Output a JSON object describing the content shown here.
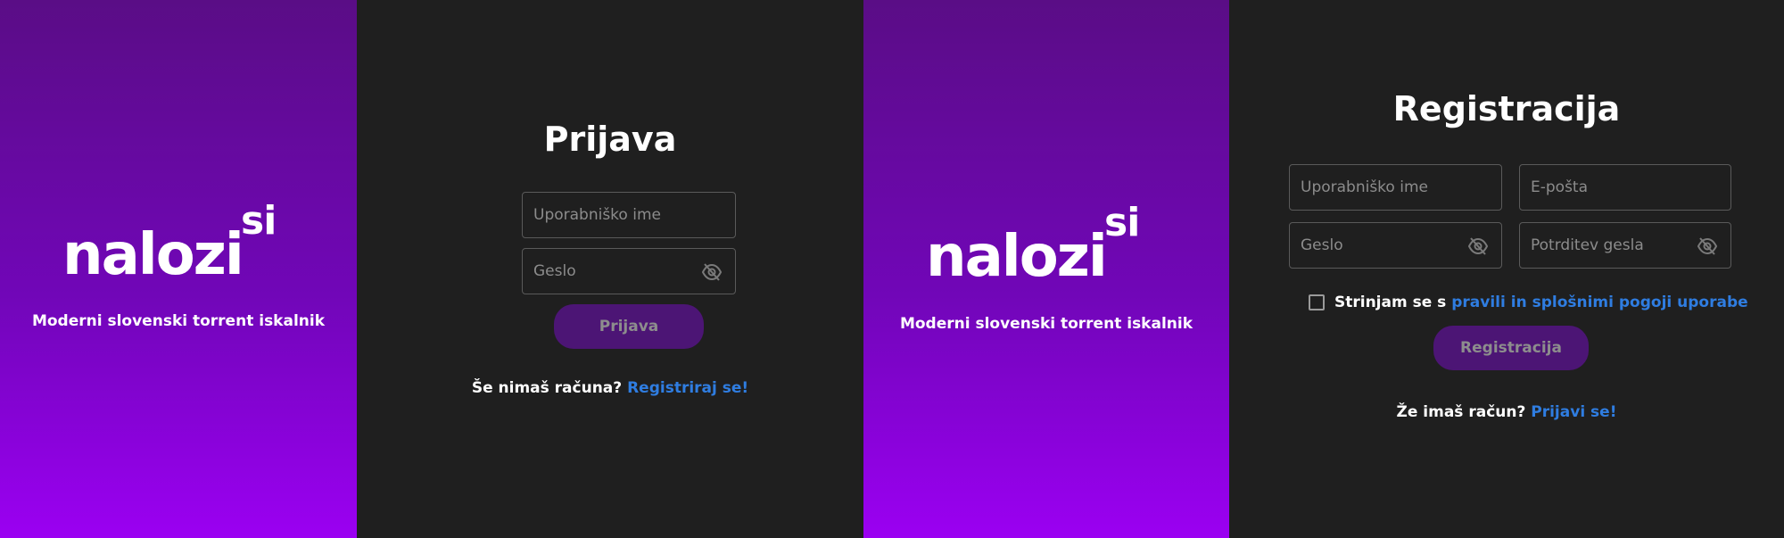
{
  "brand": {
    "logo_main": "nalozi",
    "logo_sup": "si",
    "tagline": "Moderni slovenski torrent iskalnik"
  },
  "login": {
    "title": "Prijava",
    "username_placeholder": "Uporabniško ime",
    "password_placeholder": "Geslo",
    "submit_label": "Prijava",
    "footer_text": "Še nimaš računa?",
    "footer_link": "Registriraj se!"
  },
  "register": {
    "title": "Registracija",
    "username_placeholder": "Uporabniško ime",
    "email_placeholder": "E-pošta",
    "password_placeholder": "Geslo",
    "confirm_placeholder": "Potrditev gesla",
    "terms_text": "Strinjam se s",
    "terms_link": "pravili in splošnimi pogoji uporabe",
    "terms_checked": false,
    "submit_label": "Registracija",
    "footer_text": "Že imaš račun?",
    "footer_link": "Prijavi se!"
  },
  "icons": {
    "password_toggle": "eye-off-icon"
  },
  "colors": {
    "accent_purple": "#8a00e6",
    "button_purple": "#4c1575",
    "link_blue": "#2f7de1",
    "background_dark": "#1f1f1f"
  }
}
